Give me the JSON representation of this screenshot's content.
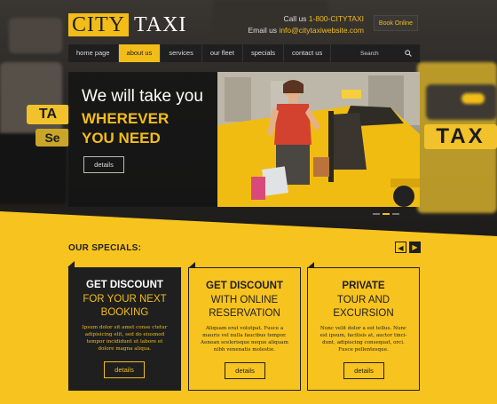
{
  "brand": {
    "city": "CITY",
    "taxi": "TAXI"
  },
  "contact": {
    "call_label": "Call us",
    "phone": "1-800-CITYTAXI",
    "email_label": "Email us",
    "email": "info@citytaxiwebsite.com"
  },
  "book_button": "Book Online",
  "nav": {
    "items": [
      "home page",
      "about us",
      "services",
      "our fleet",
      "specials",
      "contact us"
    ],
    "active_index": 1,
    "search_placeholder": "Search"
  },
  "slide": {
    "line1": "We will take you",
    "line2": "WHEREVER",
    "line3": "YOU NEED",
    "button": "details",
    "total_slides": 3,
    "active_slide": 2
  },
  "background_signs": [
    "TA",
    "Se",
    "TAX"
  ],
  "specials": {
    "title": "OUR SPECIALS:",
    "prev_icon": "arrow-left-icon",
    "next_icon": "arrow-right-icon",
    "cards": [
      {
        "title1": "GET DISCOUNT",
        "title2": "FOR YOUR NEXT",
        "title3": "BOOKING",
        "text": "Ipsum dolor sit amet conse ctetur adipisicing elit, sed do eiusmod tempor incididunt ut labore et dolore magna aliqua.",
        "button": "details"
      },
      {
        "title1": "GET DISCOUNT",
        "title2": "WITH ONLINE",
        "title3": "RESERVATION",
        "text": "Aliquam erat volutpat. Fusce a mauris vel nulla faucibus tempor. Aenean scelerisque neque aliquam nibh venenatis molestie.",
        "button": "details"
      },
      {
        "title1": "PRIVATE",
        "title2": "TOUR AND",
        "title3": "EXCURSION",
        "text": "Nunc velit dolor a est tellus. Nunc est ipsum, facilisis at, auctor tinci-dunt, adipiscing consequat, orci. Fusce pellentesque.",
        "button": "details"
      }
    ]
  },
  "colors": {
    "accent": "#f3bd19",
    "dark": "#1f1f1f"
  }
}
